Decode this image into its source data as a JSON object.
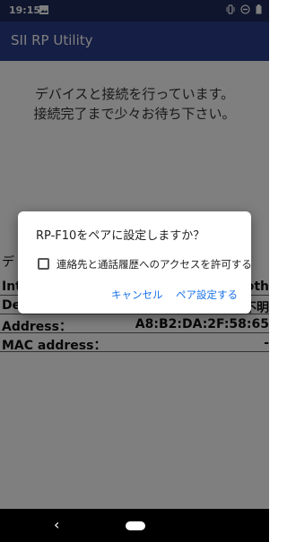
{
  "status_bar": {
    "time": "19:15",
    "icons": [
      "image-icon",
      "vibrate-icon",
      "dnd-icon",
      "battery-icon"
    ]
  },
  "app_bar": {
    "title": "SII RP Utility"
  },
  "main": {
    "message_line1": "デバイスと接続を行っています。",
    "message_line2": "接続完了まで少々お待ち下さい。",
    "info_partial_header": "デ",
    "rows": [
      {
        "key": "Inte",
        "value": "oth"
      },
      {
        "key": "De",
        "value": "不明"
      },
      {
        "key": "Address：",
        "value": "A8:B2:DA:2F:58:65"
      },
      {
        "key": "MAC address：",
        "value": "-"
      }
    ]
  },
  "dialog": {
    "title": "RP-F10をペアに設定しますか？",
    "checkbox_label": "連絡先と通話履歴へのアクセスを許可する",
    "cancel_label": "キャンセル",
    "pair_label": "ペア設定する"
  },
  "colors": {
    "status_bar": "#1d2a5a",
    "app_bar": "#2b3d88",
    "spinner": "#c2185b",
    "dialog_button": "#1a73e8"
  }
}
